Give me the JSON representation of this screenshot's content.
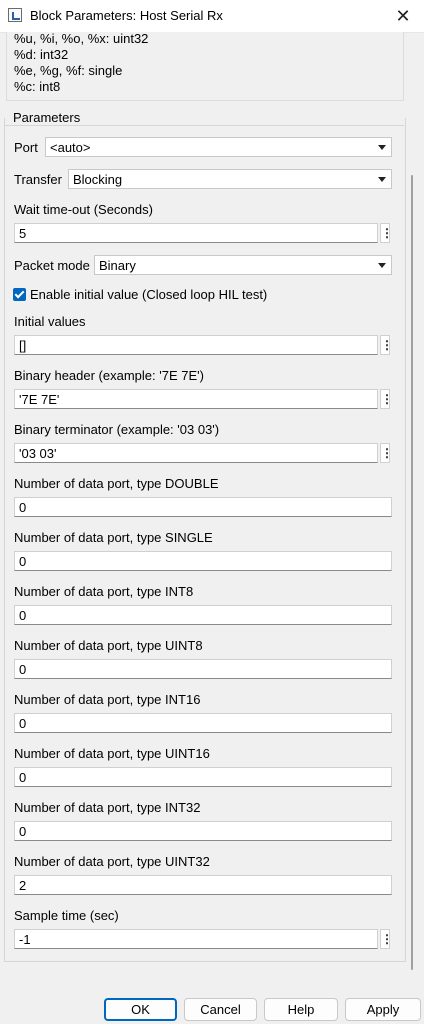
{
  "window": {
    "title": "Block Parameters: Host Serial Rx",
    "close_glyph": "✕"
  },
  "description_lines": [
    "%u, %i, %o, %x: uint32",
    "%d: int32",
    "%e, %g, %f: single",
    "%c: int8"
  ],
  "parameters": {
    "group_title": "Parameters",
    "port": {
      "label": "Port",
      "value": "<auto>"
    },
    "transfer": {
      "label": "Transfer",
      "value": "Blocking"
    },
    "wait_timeout": {
      "label": "Wait time-out (Seconds)",
      "value": "5"
    },
    "packet_mode": {
      "label": "Packet mode",
      "value": "Binary"
    },
    "enable_initial": {
      "label": "Enable initial value (Closed loop HIL test)",
      "checked": true
    },
    "initial_values": {
      "label": "Initial values",
      "value": "[]"
    },
    "binary_header": {
      "label": "Binary header (example: '7E 7E')",
      "value": "'7E 7E'"
    },
    "binary_terminator": {
      "label": "Binary terminator (example: '03 03')",
      "value": "'03 03'"
    },
    "ports": [
      {
        "label": "Number of data port, type DOUBLE",
        "value": "0"
      },
      {
        "label": "Number of data port, type SINGLE",
        "value": "0"
      },
      {
        "label": "Number of data port, type INT8",
        "value": "0"
      },
      {
        "label": "Number of data port, type UINT8",
        "value": "0"
      },
      {
        "label": "Number of data port, type INT16",
        "value": "0"
      },
      {
        "label": "Number of data port, type UINT16",
        "value": "0"
      },
      {
        "label": "Number of data port, type INT32",
        "value": "0"
      },
      {
        "label": "Number of data port, type UINT32",
        "value": "2"
      }
    ],
    "sample_time": {
      "label": "Sample time (sec)",
      "value": "-1"
    },
    "menu_glyph": "⋮"
  },
  "buttons": {
    "ok": "OK",
    "cancel": "Cancel",
    "help": "Help",
    "apply": "Apply"
  },
  "colors": {
    "accent": "#0067c0"
  }
}
